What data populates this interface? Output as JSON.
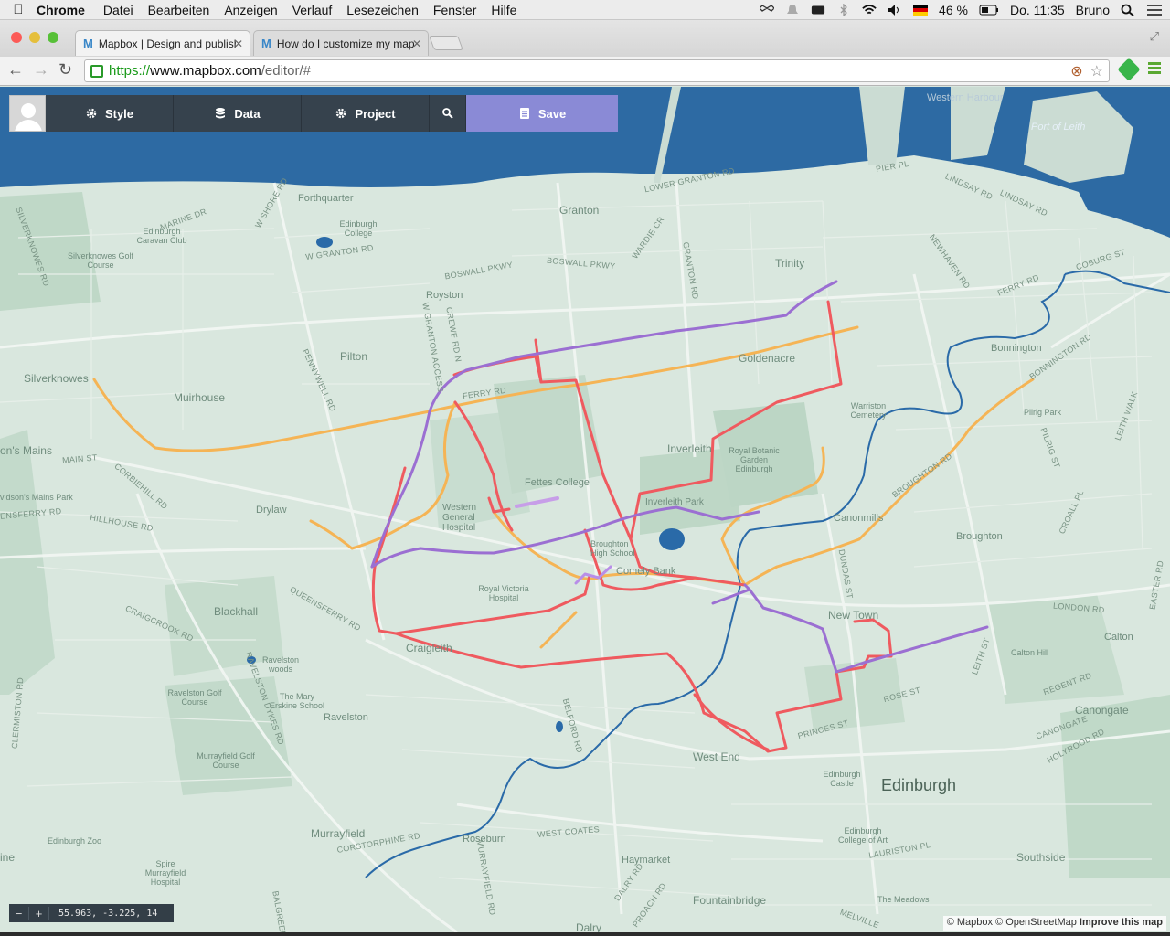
{
  "menubar": {
    "app": "Chrome",
    "items": [
      "Datei",
      "Bearbeiten",
      "Anzeigen",
      "Verlauf",
      "Lesezeichen",
      "Fenster",
      "Hilfe"
    ],
    "battery": "46 %",
    "clock": "Do. 11:35",
    "user": "Bruno"
  },
  "tabs": [
    {
      "title": "Mapbox | Design and publish"
    },
    {
      "title": "How do I customize my map"
    }
  ],
  "address": {
    "https": "https://",
    "host": "www.mapbox.com",
    "path": "/editor/#"
  },
  "editor": {
    "style_label": "Style",
    "data_label": "Data",
    "project_label": "Project",
    "save_label": "Save"
  },
  "map": {
    "coordinates": "55.963, -3.225, 14",
    "attribution_1": "© Mapbox © OpenStreetMap",
    "attribution_2": "Improve this map",
    "route_colors": {
      "red": "#ef5a5f",
      "purple": "#9b6fd2",
      "orange": "#f5b455"
    },
    "water_color": "#2a6aa8",
    "labels": {
      "port_of_leith": "Port of Leith",
      "western_harbour": "Western Harbour",
      "forthquarter": "Forthquarter",
      "granton": "Granton",
      "trinity": "Trinity",
      "royston": "Royston",
      "pilton": "Pilton",
      "goldenacre": "Goldenacre",
      "bonnington": "Bonnington",
      "silverknowes": "Silverknowes",
      "muirhouse": "Muirhouse",
      "inverleith": "Inverleith",
      "fettes_college": "Fettes College",
      "western_general": "Western General Hospital",
      "drylaw": "Drylaw",
      "broughton_high": "Broughton High School",
      "comely_bank": "Comely Bank",
      "inverleith_park": "Inverleith Park",
      "canonmills": "Canonmills",
      "broughton": "Broughton",
      "royal_botanic": "Royal Botanic Garden Edinburgh",
      "warriston": "Warriston Cemetery",
      "pilrig_park": "Pilrig Park",
      "blackhall": "Blackhall",
      "royal_victoria": "Royal Victoria Hospital",
      "craigleith": "Craigleith",
      "new_town": "New Town",
      "calton": "Calton",
      "calton_hill": "Calton Hill",
      "canongate": "Canongate",
      "west_end": "West End",
      "edinburgh": "Edinburgh",
      "edinburgh_castle": "Edinburgh Castle",
      "ravelston": "Ravelston",
      "ravelston_woods": "Ravelston woods",
      "ravelston_golf": "Ravelston Golf Course",
      "mary_erskine": "The Mary Erskine School",
      "murrayfield_golf": "Murrayfield Golf Course",
      "murrayfield": "Murrayfield",
      "roseburn": "Roseburn",
      "haymarket": "Haymarket",
      "fountainbridge": "Fountainbridge",
      "southside": "Southside",
      "the_meadows": "The Meadows",
      "edinburgh_college_art": "Edinburgh College of Art",
      "edinburgh_zoo": "Edinburgh Zoo",
      "spire_murrayfield": "Spire Murrayfield Hospital",
      "dalry": "Dalry",
      "silverknowes_golf": "Silverknowes Golf Course",
      "edinburgh_caravan": "Edinburgh Caravan Club",
      "edinburgh_college": "Edinburgh College",
      "davidsons_mains": "on's Mains",
      "davidsons_park": "vidson's Mains Park",
      "ine": "ine"
    },
    "streets": {
      "lower_granton": "LOWER GRANTON RD",
      "pier_pl": "PIER PL",
      "lindsay_rd": "LINDSAY RD",
      "lindsay_rd2": "LINDSAY RD",
      "coburg_st": "COBURG ST",
      "ferry_rd": "FERRY RD",
      "ferry_rd2": "FERRY RD",
      "marine_dr": "MARINE DR",
      "w_shore_rd": "W SHORE RD",
      "w_granton_rd": "W GRANTON RD",
      "boswall_pkwy": "BOSWALL PKWY",
      "boswall_pkwy2": "BOSWALL PKWY",
      "wardie_cr": "WARDIE CR",
      "granton_rd": "GRANTON RD",
      "newhaven_rd": "NEWHAVEN RD",
      "silverknowes_rd": "SILVERKNOWES RD",
      "main_st": "MAIN ST",
      "corbiehill_rd": "CORBIEHILL RD",
      "hillhouse_rd": "HILLHOUSE RD",
      "queensferry_rd": "QUEENSFERRY RD",
      "queensferry_rd2": "ENSFERRY RD",
      "craigcrook_rd": "CRAIGCROOK RD",
      "ravelston_dykes": "RAVELSTON DYKES RD",
      "pennywell_rd": "PENNYWELL RD",
      "crewe_rd": "CREWE RD N",
      "w_granton_access": "W GRANTON ACCESS",
      "belford_rd": "BELFORD RD",
      "princes_st": "PRINCES ST",
      "rose_st": "ROSE ST",
      "dundas_st": "DUNDAS ST",
      "london_rd": "LONDON RD",
      "regent_rd": "REGENT RD",
      "leith_st": "LEITH ST",
      "canongate_st": "CANONGATE",
      "holyrood_rd": "HOLYROOD RD",
      "west_coates": "WEST COATES",
      "corstorphine_rd": "CORSTORPHINE RD",
      "dalry_rd": "DALRY RD",
      "lauriston_pl": "LAURISTON PL",
      "broughton_rd": "BROUGHTON RD",
      "bonnington_rd": "BONNINGTON RD",
      "pilrig_st": "PILRIG ST",
      "leith_walk": "LEITH WALK",
      "easter_rd": "EASTER RD",
      "croall_pl": "CROALL PL",
      "clermiston_rd": "CLERMISTON RD",
      "murrayfield_rd": "MURRAYFIELD RD",
      "balgreen": "BALGREEN",
      "melville": "MELVILLE",
      "fountainbridge_rd": "PROACH RD"
    }
  }
}
